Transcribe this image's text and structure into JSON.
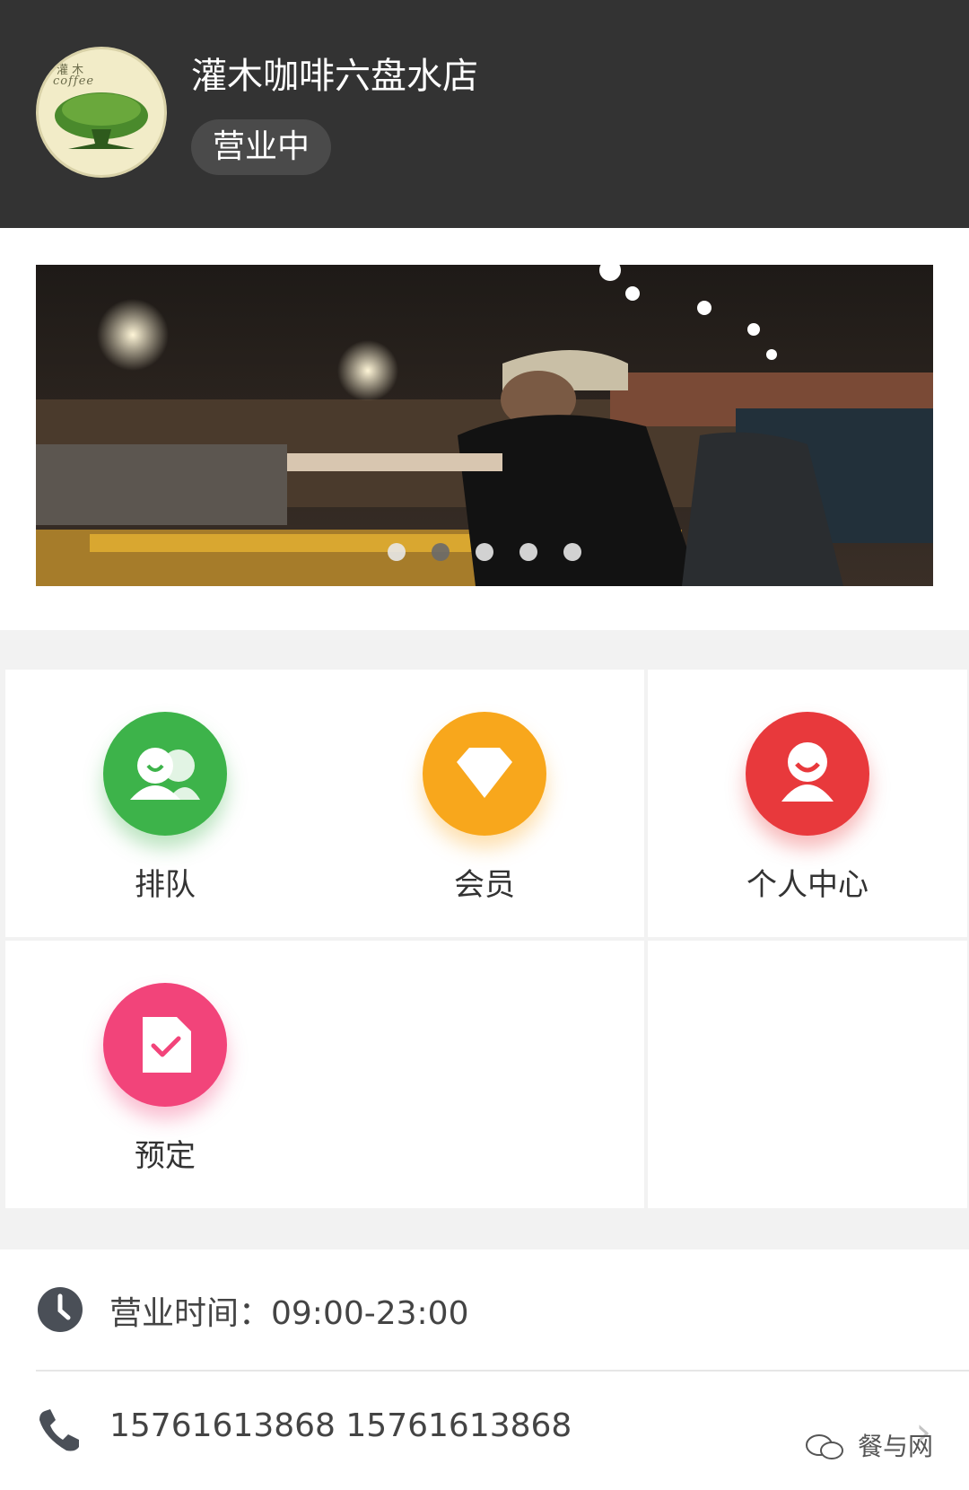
{
  "header": {
    "shop_name": "灌木咖啡六盘水店",
    "status": "营业中",
    "logo": {
      "top_text": "灌 木",
      "brand_text": "coffee"
    }
  },
  "banner": {
    "dots_count": 5,
    "active_dot": 1
  },
  "menu": {
    "items": [
      {
        "label": "排队",
        "icon": "queue-icon",
        "color": "#3db34a"
      },
      {
        "label": "会员",
        "icon": "diamond-icon",
        "color": "#f8a71c"
      },
      {
        "label": "个人中心",
        "icon": "profile-icon",
        "color": "#e8393c"
      },
      {
        "label": "预定",
        "icon": "reservation-icon",
        "color": "#f2447a"
      }
    ]
  },
  "info": {
    "hours": "营业时间：09:00-23:00",
    "phone": "15761613868 15761613868",
    "watermark": "餐与网"
  },
  "colors": {
    "header_bg": "#333333",
    "page_bg": "#f2f2f2"
  }
}
